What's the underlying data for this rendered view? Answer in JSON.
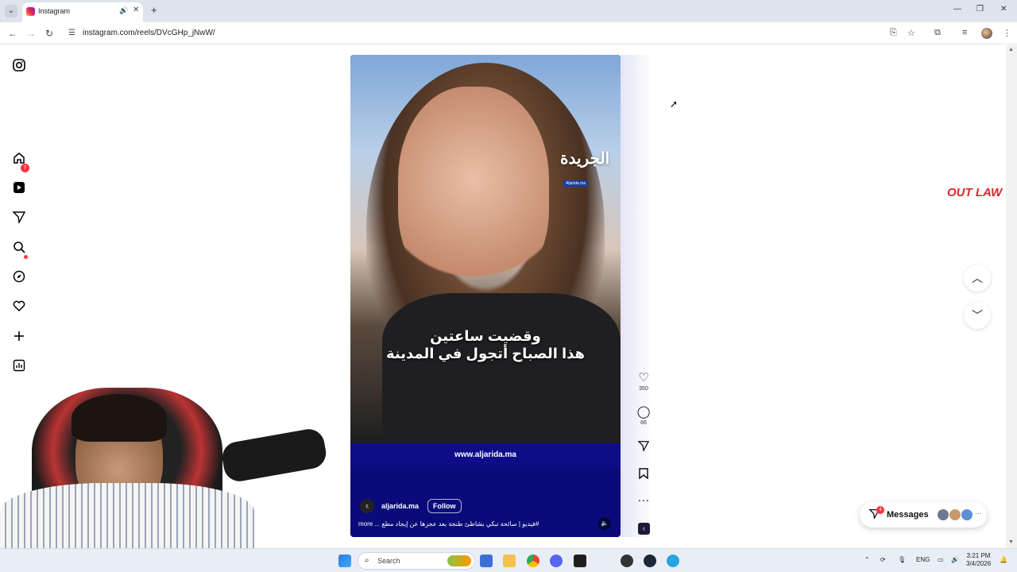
{
  "browser": {
    "tab_title": "Instagram",
    "url": "instagram.com/reels/DVcGHp_jNwW/"
  },
  "nav": {
    "notifications_badge": "7"
  },
  "reel": {
    "watermark": "الجريدة",
    "watermark_sub": "Aljarida.ma",
    "caption_line1": "وقضيت ساعتين",
    "caption_line2": "هذا الصباح أتجول في المدينة",
    "site": "www.aljarida.ma",
    "author": "aljarida.ma",
    "follow_label": "Follow",
    "description": "more ... فيديو | سائحة تبكي بشاطئ طنجة بعد عجزها عن إيجاد مطع#"
  },
  "actions": {
    "likes": "350",
    "comments": "66"
  },
  "messages": {
    "label": "Messages",
    "badge": "4"
  },
  "overlay_logo": "OUT LAW",
  "taskbar": {
    "search_placeholder": "Search",
    "lang": "ENG",
    "time": "3:21 PM",
    "date": "3/4/2026"
  }
}
